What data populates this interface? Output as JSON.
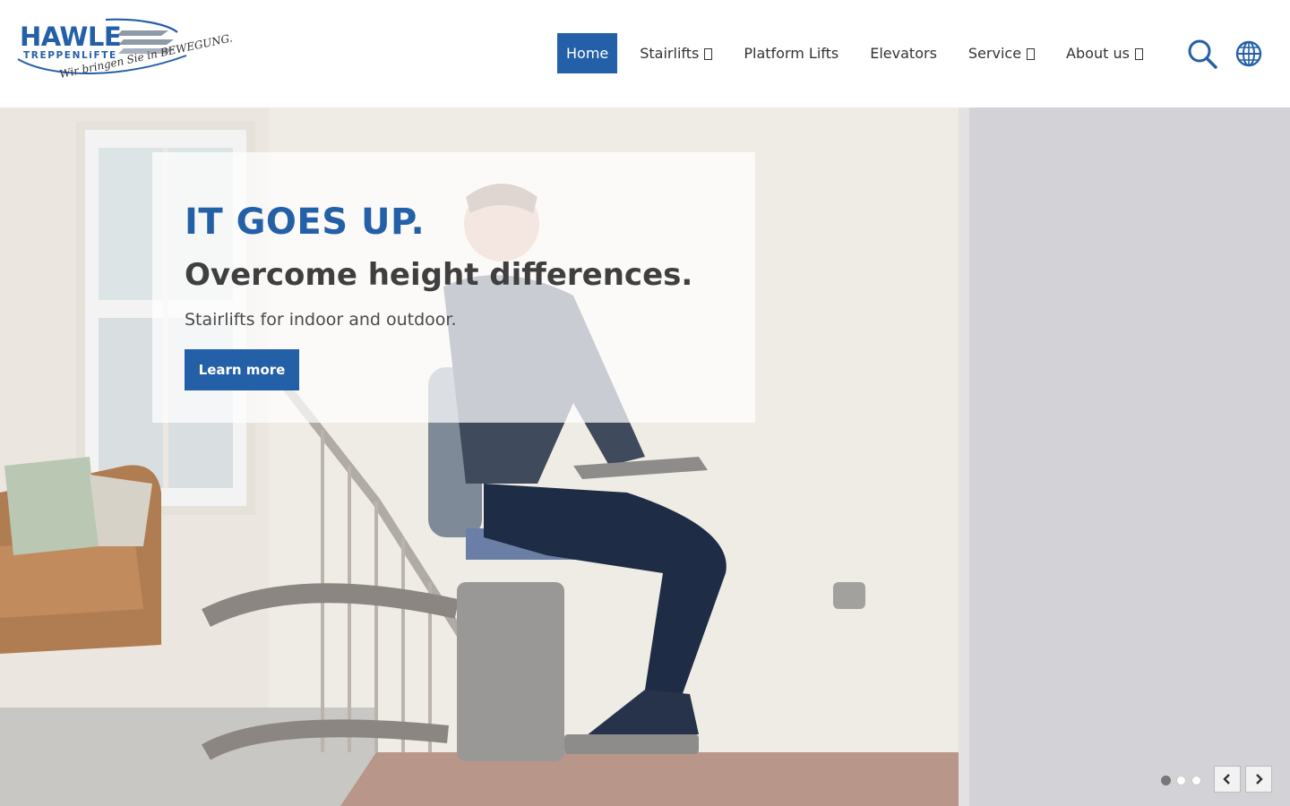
{
  "logo": {
    "brand": "HAWLE",
    "sub": "TREPPENLiFTE",
    "tagline": "Wir bringen Sie in BEWEGUNG."
  },
  "nav": {
    "items": [
      {
        "label": "Home",
        "active": true,
        "has_dropdown": false
      },
      {
        "label": "Stairlifts",
        "active": false,
        "has_dropdown": true
      },
      {
        "label": "Platform Lifts",
        "active": false,
        "has_dropdown": false
      },
      {
        "label": "Elevators",
        "active": false,
        "has_dropdown": false
      },
      {
        "label": "Service",
        "active": false,
        "has_dropdown": true
      },
      {
        "label": "About us",
        "active": false,
        "has_dropdown": true
      }
    ],
    "icons": [
      "search-icon",
      "globe-icon"
    ]
  },
  "hero": {
    "headline": "IT GOES UP.",
    "subheadline": "Overcome height differences.",
    "lead": "Stairlifts for indoor and outdoor.",
    "cta": "Learn more",
    "slides_total": 3,
    "active_slide": 1
  },
  "colors": {
    "brand_blue": "#2460a7",
    "text_dark": "#3f3f3f"
  }
}
